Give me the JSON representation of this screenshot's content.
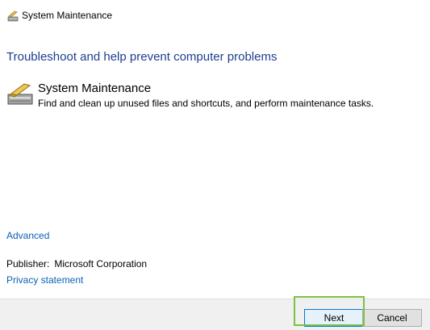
{
  "window": {
    "title": "System Maintenance",
    "icon": "system-maintenance-icon"
  },
  "main": {
    "headline": "Troubleshoot and help prevent computer problems",
    "task": {
      "title": "System Maintenance",
      "description": "Find and clean up unused files and shortcuts, and perform maintenance tasks.",
      "icon": "system-maintenance-icon"
    },
    "advanced_link": "Advanced",
    "publisher_label": "Publisher:",
    "publisher_value": "Microsoft Corporation",
    "privacy_link": "Privacy statement"
  },
  "footer": {
    "next_label": "Next",
    "cancel_label": "Cancel"
  },
  "colors": {
    "headline": "#1e3f8f",
    "link": "#0a62b7",
    "highlight": "#7bc143"
  }
}
